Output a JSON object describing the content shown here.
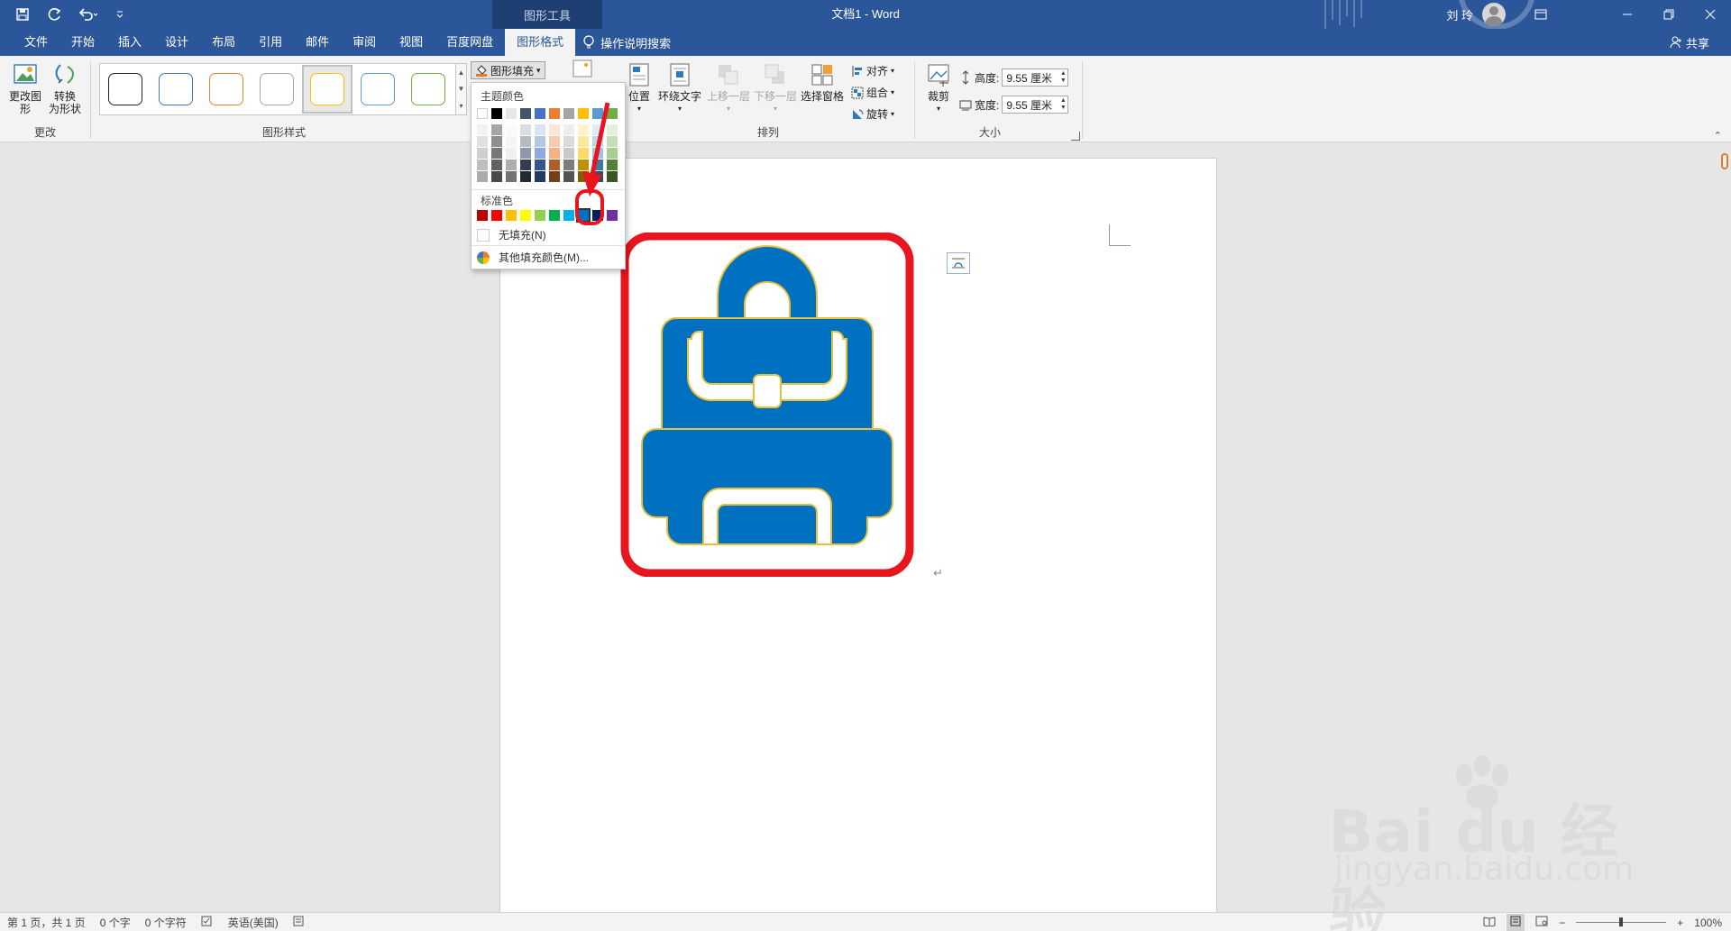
{
  "titlebar": {
    "contextual_group": "图形工具",
    "doc_title": "文档1 - Word",
    "user_name": "刘 玲"
  },
  "tabs": [
    {
      "label": "文件"
    },
    {
      "label": "开始"
    },
    {
      "label": "插入"
    },
    {
      "label": "设计"
    },
    {
      "label": "布局"
    },
    {
      "label": "引用"
    },
    {
      "label": "邮件"
    },
    {
      "label": "审阅"
    },
    {
      "label": "视图"
    },
    {
      "label": "百度网盘"
    },
    {
      "label": "图形格式"
    }
  ],
  "tell_me": "操作说明搜索",
  "share": "共享",
  "ribbon": {
    "change_group": {
      "label": "更改",
      "change_image_line1": "更改图",
      "change_image_line2": "形",
      "convert_line1": "转换",
      "convert_line2": "为形状"
    },
    "styles_group": {
      "label": "图形样式",
      "swatch_colors": [
        "#222222",
        "#4472c4",
        "#ed7d31",
        "#a5a5a5",
        "#ffc000",
        "#5b9bd5",
        "#70ad47"
      ],
      "selected_index": 4
    },
    "fill_button": "图形填充",
    "arrange_group": {
      "label": "排列",
      "position": "位置",
      "wrap_text": "环绕文字",
      "bring_forward": "上移一层",
      "send_backward": "下移一层",
      "selection_pane": "选择窗格",
      "align": "对齐",
      "group": "组合",
      "rotate": "旋转"
    },
    "crop": "裁剪",
    "size_group": {
      "label": "大小",
      "height_label": "高度:",
      "height_value": "9.55 厘米",
      "width_label": "宽度:",
      "width_value": "9.55 厘米"
    }
  },
  "dropdown": {
    "theme_colors_heading": "主题颜色",
    "standard_colors_heading": "标准色",
    "no_fill": "无填充(N)",
    "more_colors": "其他填充颜色(M)...",
    "theme_top": [
      "#ffffff",
      "#000000",
      "#e7e6e6",
      "#44546a",
      "#4472c4",
      "#ed7d31",
      "#a5a5a5",
      "#ffc000",
      "#5b9bd5",
      "#70ad47"
    ],
    "standard": [
      "#c00000",
      "#ff0000",
      "#ffc000",
      "#ffff00",
      "#92d050",
      "#00b050",
      "#00b0f0",
      "#0070c0",
      "#002060",
      "#7030a0"
    ],
    "highlighted_standard_index": 7
  },
  "document": {
    "backpack_fill": "#0070c0",
    "backpack_outline": "#e8c13a",
    "highlight_color": "#e8141e"
  },
  "statusbar": {
    "page": "第 1 页，共 1 页",
    "words": "0 个字",
    "chars": "0 个字符",
    "language": "英语(美国)",
    "zoom": "100%"
  },
  "watermark": {
    "main": "Bai du 经验",
    "sub": "jingyan.baidu.com"
  }
}
